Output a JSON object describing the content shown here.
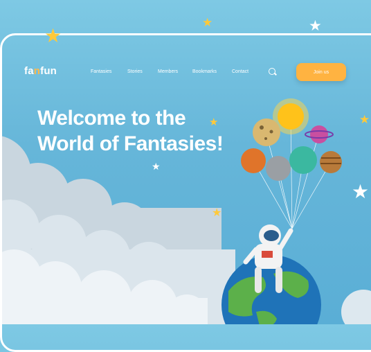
{
  "brand": {
    "prefix": "fa",
    "accent": "n",
    "suffix": "fun"
  },
  "nav": {
    "items": [
      "Fantasies",
      "Stories",
      "Members",
      "Bookmarks",
      "Contact"
    ],
    "join_label": "Join us"
  },
  "hero": {
    "line1": "Welcome to the",
    "line2": "World of Fantasies!"
  },
  "colors": {
    "accent": "#ffb341",
    "sky": "#66b6d9",
    "cloud": "#eef3f7"
  }
}
